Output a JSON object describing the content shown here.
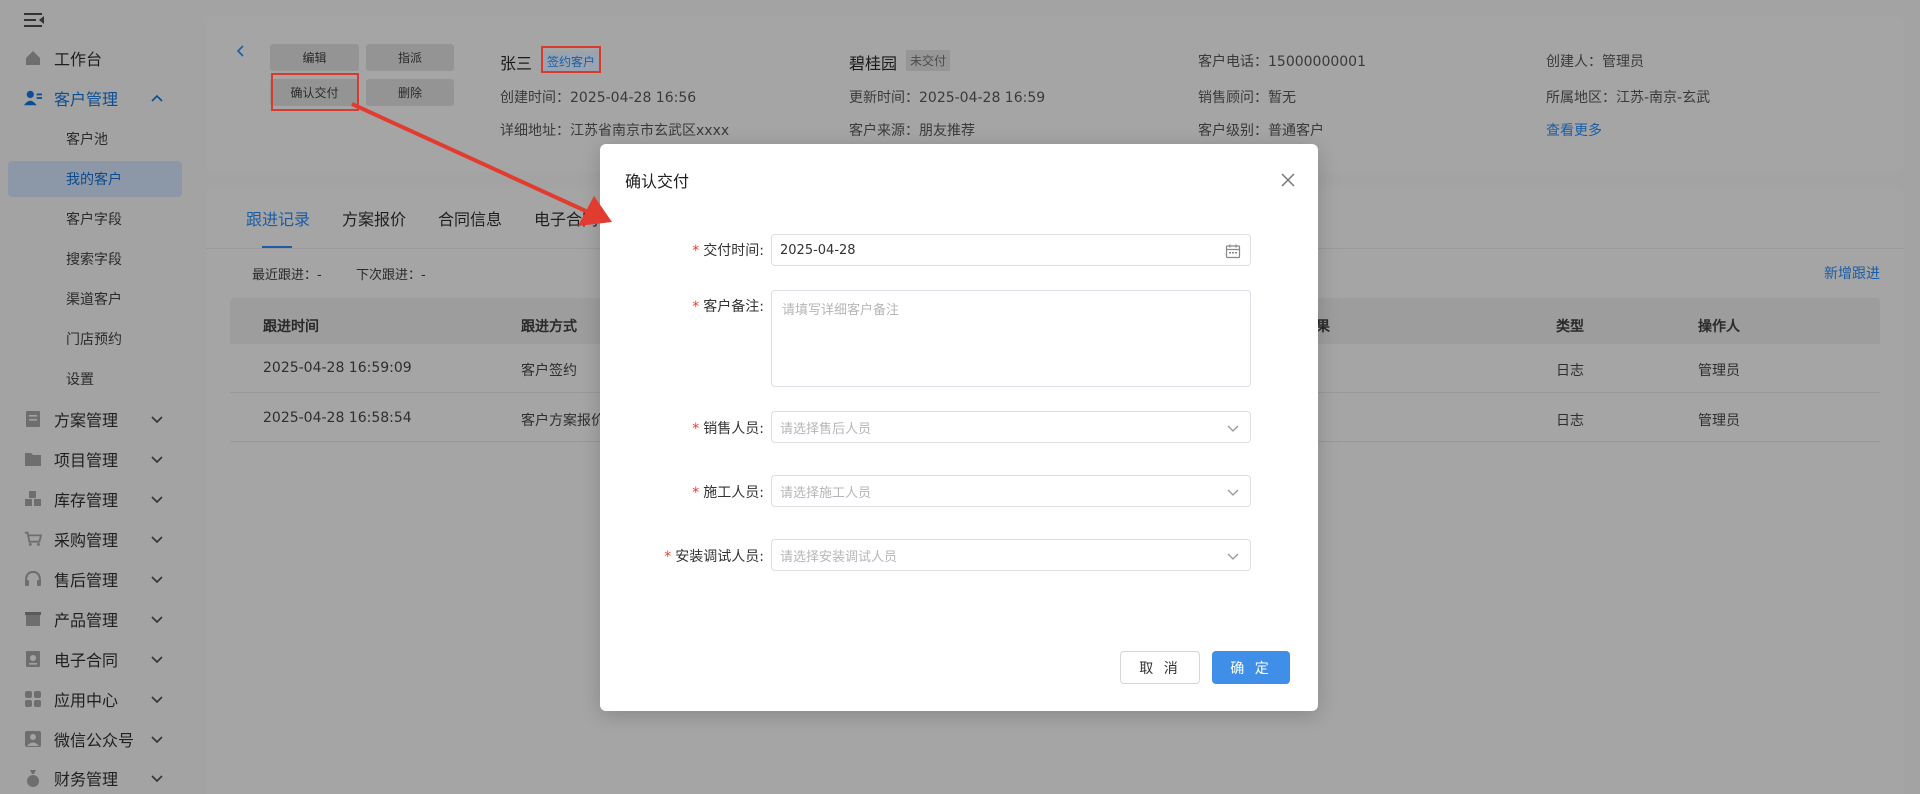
{
  "colors": {
    "accent": "#3f8fe8",
    "link": "#1c5da4",
    "required": "#e23b2f",
    "annotation": "#d93a2f",
    "overlay": "#a3a3a3"
  },
  "sidebar": {
    "toggle_icon": "menu-fold-icon",
    "workbench": "工作台",
    "customer_mgmt": "客户管理",
    "sub_items": [
      "客户池",
      "我的客户",
      "客户字段",
      "搜索字段",
      "渠道客户",
      "门店预约",
      "设置"
    ],
    "groups": [
      "方案管理",
      "项目管理",
      "库存管理",
      "采购管理",
      "售后管理",
      "产品管理",
      "电子合同",
      "应用中心",
      "微信公众号",
      "财务管理"
    ]
  },
  "header": {
    "actions": {
      "edit": "编辑",
      "assign": "指派",
      "confirm_delivery": "确认交付",
      "delete": "删除"
    },
    "customer_name": "张三",
    "customer_tag": "签约客户",
    "created_time": "创建时间：2025-04-28 16:56",
    "address": "详细地址：江苏省南京市玄武区xxxx",
    "project_name": "碧桂园",
    "project_tag": "未交付",
    "updated_time": "更新时间：2025-04-28 16:59",
    "source": "客户来源：朋友推荐",
    "phone": "客户电话：15000000001",
    "sales_advisor": "销售顾问：暂无",
    "level": "客户级别：普通客户",
    "creator": "创建人：管理员",
    "region": "所属地区：江苏-南京-玄武",
    "view_more": "查看更多"
  },
  "tabs": [
    "跟进记录",
    "方案报价",
    "合同信息",
    "电子合同"
  ],
  "follow": {
    "recent": "最近跟进：-",
    "next": "下次跟进：-",
    "add": "新增跟进"
  },
  "table": {
    "headers": {
      "time": "跟进时间",
      "method": "跟进方式",
      "result": "果",
      "type": "类型",
      "operator": "操作人"
    },
    "rows": [
      {
        "time": "2025-04-28 16:59:09",
        "method": "客户签约",
        "type": "日志",
        "operator": "管理员"
      },
      {
        "time": "2025-04-28 16:58:54",
        "method": "客户方案报价",
        "type": "日志",
        "operator": "管理员"
      }
    ]
  },
  "modal": {
    "title": "确认交付",
    "close_icon": "close-icon",
    "fields": {
      "delivery_time": {
        "label": "交付时间:",
        "value": "2025-04-28"
      },
      "remark": {
        "label": "客户备注:",
        "placeholder": "请填写详细客户备注"
      },
      "sales": {
        "label": "销售人员:",
        "placeholder": "请选择售后人员"
      },
      "construction": {
        "label": "施工人员:",
        "placeholder": "请选择施工人员"
      },
      "installer": {
        "label": "安装调试人员:",
        "placeholder": "请选择安装调试人员"
      }
    },
    "cancel": "取 消",
    "ok": "确 定"
  }
}
